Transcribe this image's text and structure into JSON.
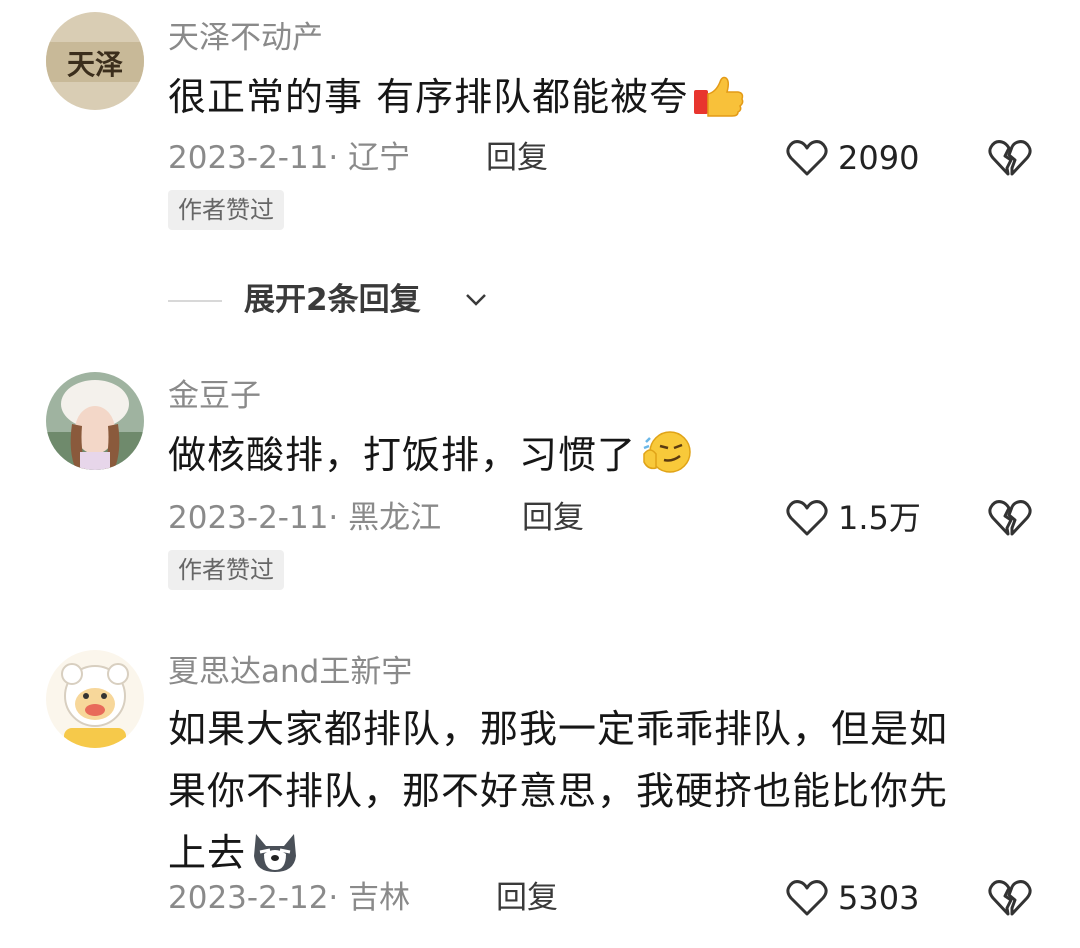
{
  "comments": [
    {
      "username": "天泽不动产",
      "avatar_text": "天泽",
      "text": "很正常的事 有序排队都能被夸",
      "emoji": "thumbs-up-icon",
      "date": "2023-2-11· 辽宁",
      "reply": "回复",
      "likes": "2090",
      "badge": "作者赞过"
    },
    {
      "username": "金豆子",
      "text": "做核酸排，打饭排，习惯了",
      "emoji": "smirk-face-icon",
      "date": "2023-2-11· 黑龙江",
      "reply": "回复",
      "likes": "1.5万",
      "badge": "作者赞过"
    },
    {
      "username": "夏思达and王新宇",
      "text_lines": [
        "如果大家都排队，那我一定乖乖排队，但是如",
        "果你不排队，那不好意思，我硬挤也能比你先",
        "上去"
      ],
      "emoji": "doge-icon",
      "date": "2023-2-12· 吉林",
      "reply": "回复",
      "likes": "5303"
    }
  ],
  "expand_replies": "展开2条回复",
  "colors": {
    "username": "#8a8a8a",
    "text": "#161616",
    "badge_bg": "#efefef"
  }
}
